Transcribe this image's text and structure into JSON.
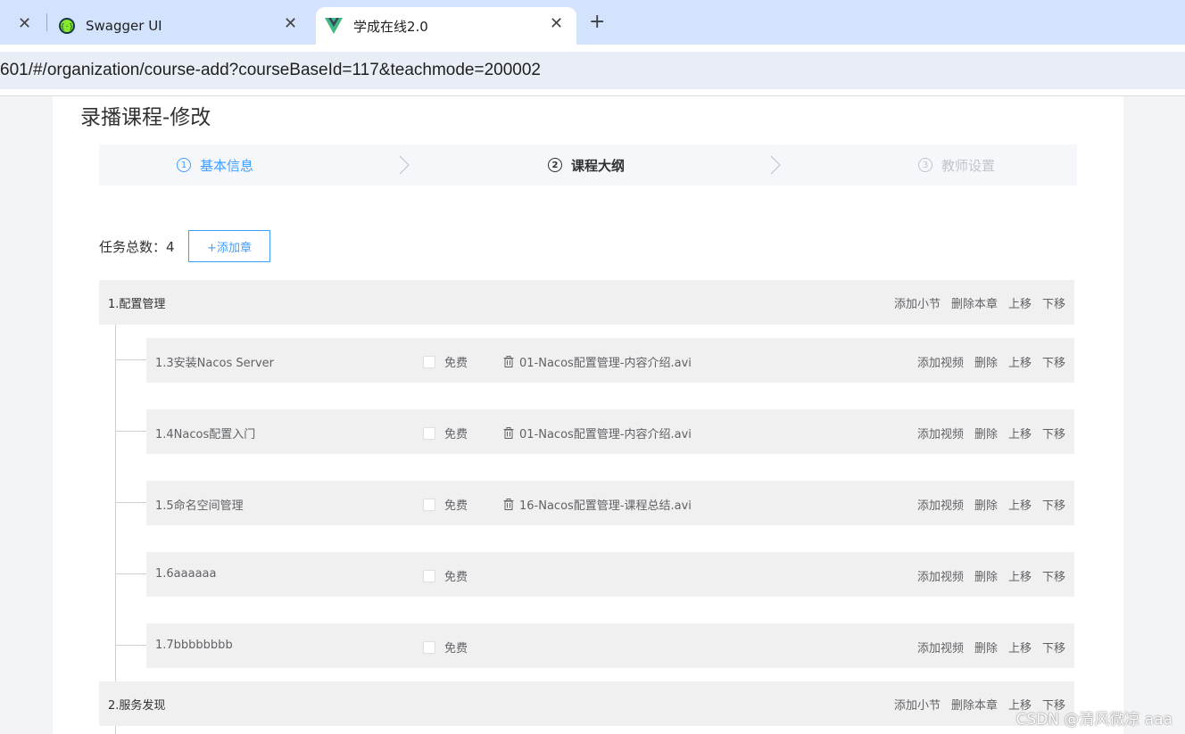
{
  "browser": {
    "tabs": [
      {
        "title": "",
        "close": "✕"
      },
      {
        "title": "Swagger UI",
        "close": "✕"
      },
      {
        "title": "学成在线2.0",
        "close": "✕"
      }
    ],
    "new_tab": "+",
    "url": "601/#/organization/course-add?courseBaseId=117&teachmode=200002"
  },
  "page": {
    "title": "录播课程-修改",
    "steps": [
      {
        "num": "1",
        "label": "基本信息"
      },
      {
        "num": "2",
        "label": "课程大纲"
      },
      {
        "num": "3",
        "label": "教师设置"
      }
    ],
    "task_total_label": "任务总数：4",
    "add_chapter_label": "+添加章"
  },
  "outline": {
    "chapters": [
      {
        "title": "1.配置管理",
        "actions": [
          "添加小节",
          "删除本章",
          "上移",
          "下移"
        ]
      },
      {
        "title": "2.服务发现",
        "actions": [
          "添加小节",
          "删除本章",
          "上移",
          "下移"
        ]
      }
    ],
    "sections": [
      {
        "title": "1.3安装Nacos Server",
        "free": "免费",
        "media": "01-Nacos配置管理-内容介绍.avi",
        "actions": [
          "添加视频",
          "删除",
          "上移",
          "下移"
        ]
      },
      {
        "title": "1.4Nacos配置入门",
        "free": "免费",
        "media": "01-Nacos配置管理-内容介绍.avi",
        "actions": [
          "添加视频",
          "删除",
          "上移",
          "下移"
        ]
      },
      {
        "title": "1.5命名空间管理",
        "free": "免费",
        "media": "16-Nacos配置管理-课程总结.avi",
        "actions": [
          "添加视频",
          "删除",
          "上移",
          "下移"
        ]
      },
      {
        "title": "1.6aaaaaa",
        "free": "免费",
        "media": "",
        "actions": [
          "添加视频",
          "删除",
          "上移",
          "下移"
        ]
      },
      {
        "title": "1.7bbbbbbbb",
        "free": "免费",
        "media": "",
        "actions": [
          "添加视频",
          "删除",
          "上移",
          "下移"
        ]
      }
    ]
  },
  "watermark": "CSDN @清风微凉 aaa",
  "colors": {
    "primary": "#409eff",
    "row_bg": "#f0f0f0",
    "tab_strip": "#d3e3fd"
  }
}
